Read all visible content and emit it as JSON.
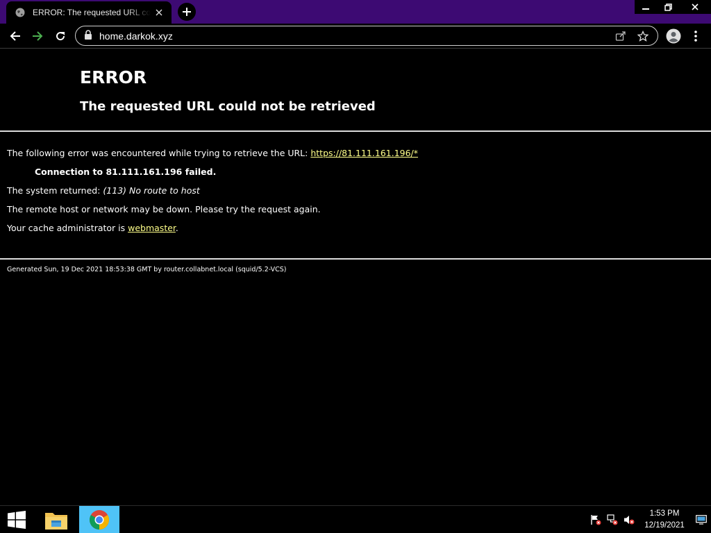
{
  "browser": {
    "tab": {
      "title": "ERROR: The requested URL could not be retrieved",
      "favicon": "globe-icon"
    },
    "address_bar": {
      "url": "home.darkok.xyz"
    },
    "colors": {
      "frame": "#3d0a73",
      "forward_arrow": "#4caf50"
    }
  },
  "page": {
    "title": "ERROR",
    "subtitle": "The requested URL could not be retrieved",
    "line1_text": "The following error was encountered while trying to retrieve the URL: ",
    "line1_link": "https://81.111.161.196/*",
    "line2": "Connection to 81.111.161.196 failed.",
    "line3_text": "The system returned: ",
    "line3_em": "(113) No route to host",
    "line4": "The remote host or network may be down. Please try the request again.",
    "line5_text": "Your cache administrator is ",
    "line5_link": "webmaster",
    "line5_end": ".",
    "footer": "Generated Sun, 19 Dec 2021 18:53:38 GMT by router.collabnet.local (squid/5.2-VCS)",
    "colors": {
      "link": "#ffff8a"
    }
  },
  "taskbar": {
    "time": "1:53 PM",
    "date": "12/19/2021",
    "apps": [
      "file-explorer-icon",
      "chrome-icon"
    ],
    "active_color": "#4fc3f7"
  }
}
